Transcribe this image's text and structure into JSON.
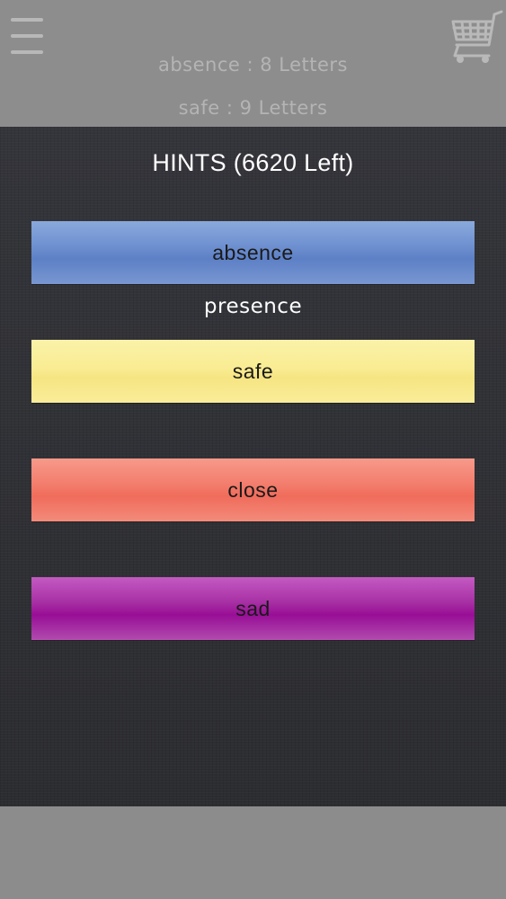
{
  "header": {
    "word_lines": [
      "absence : 8 Letters",
      "safe : 9 Letters"
    ]
  },
  "icons": {
    "menu": "menu-icon",
    "cart": "cart-icon"
  },
  "hints_modal": {
    "title": "HINTS (6620 Left)",
    "revealed_answer": "presence",
    "hints": [
      {
        "label": "absence",
        "color": "#6e90d0"
      },
      {
        "label": "safe",
        "color": "#f8eb8f"
      },
      {
        "label": "close",
        "color": "#f37866"
      },
      {
        "label": "sad",
        "color": "#a1209f"
      }
    ]
  }
}
